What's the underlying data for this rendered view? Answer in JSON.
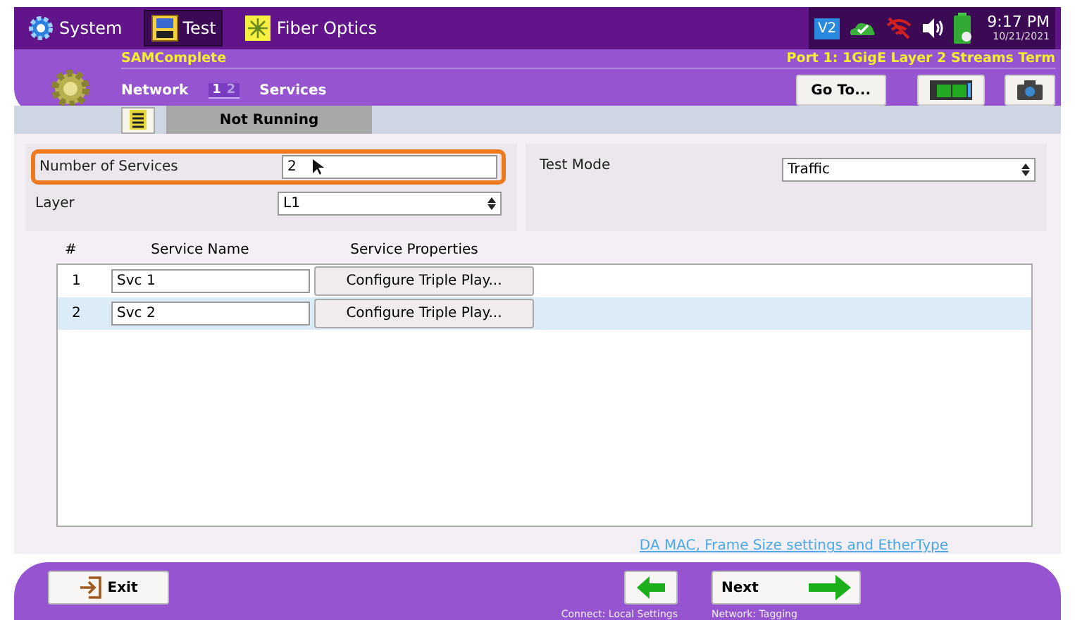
{
  "top_tabs": [
    {
      "label": "System",
      "selected": false
    },
    {
      "label": "Test",
      "selected": true
    },
    {
      "label": "Fiber Optics",
      "selected": false
    }
  ],
  "status_tray": {
    "time": "9:17 PM",
    "date": "10/21/2021",
    "badge": "V2"
  },
  "header": {
    "app": "SAMComplete",
    "port": "Port 1: 1GigE Layer 2 Streams Term",
    "nav_left": "Network",
    "steps": [
      {
        "label": "1",
        "selected": true
      },
      {
        "label": "2",
        "selected": false
      }
    ],
    "nav_right": "Services",
    "goto": "Go To..."
  },
  "status": "Not Running",
  "form": {
    "fields": [
      {
        "label": "Number of Services",
        "value": "2",
        "kind": "input",
        "highlighted": true
      },
      {
        "label": "Layer",
        "value": "L1",
        "kind": "select",
        "highlighted": false
      }
    ],
    "test_mode": {
      "label": "Test Mode",
      "value": "Traffic"
    }
  },
  "table": {
    "columns": [
      "#",
      "Service Name",
      "Service Properties"
    ],
    "rows": [
      {
        "num": "1",
        "name": "Svc 1",
        "action": "Configure Triple Play...",
        "selected": false
      },
      {
        "num": "2",
        "name": "Svc 2",
        "action": "Configure Triple Play...",
        "selected": true
      }
    ]
  },
  "link": "DA MAC, Frame Size settings and EtherType",
  "footer": {
    "exit": "Exit",
    "back_caption": "Connect: Local Settings",
    "next": "Next",
    "next_caption": "Network: Tagging"
  }
}
